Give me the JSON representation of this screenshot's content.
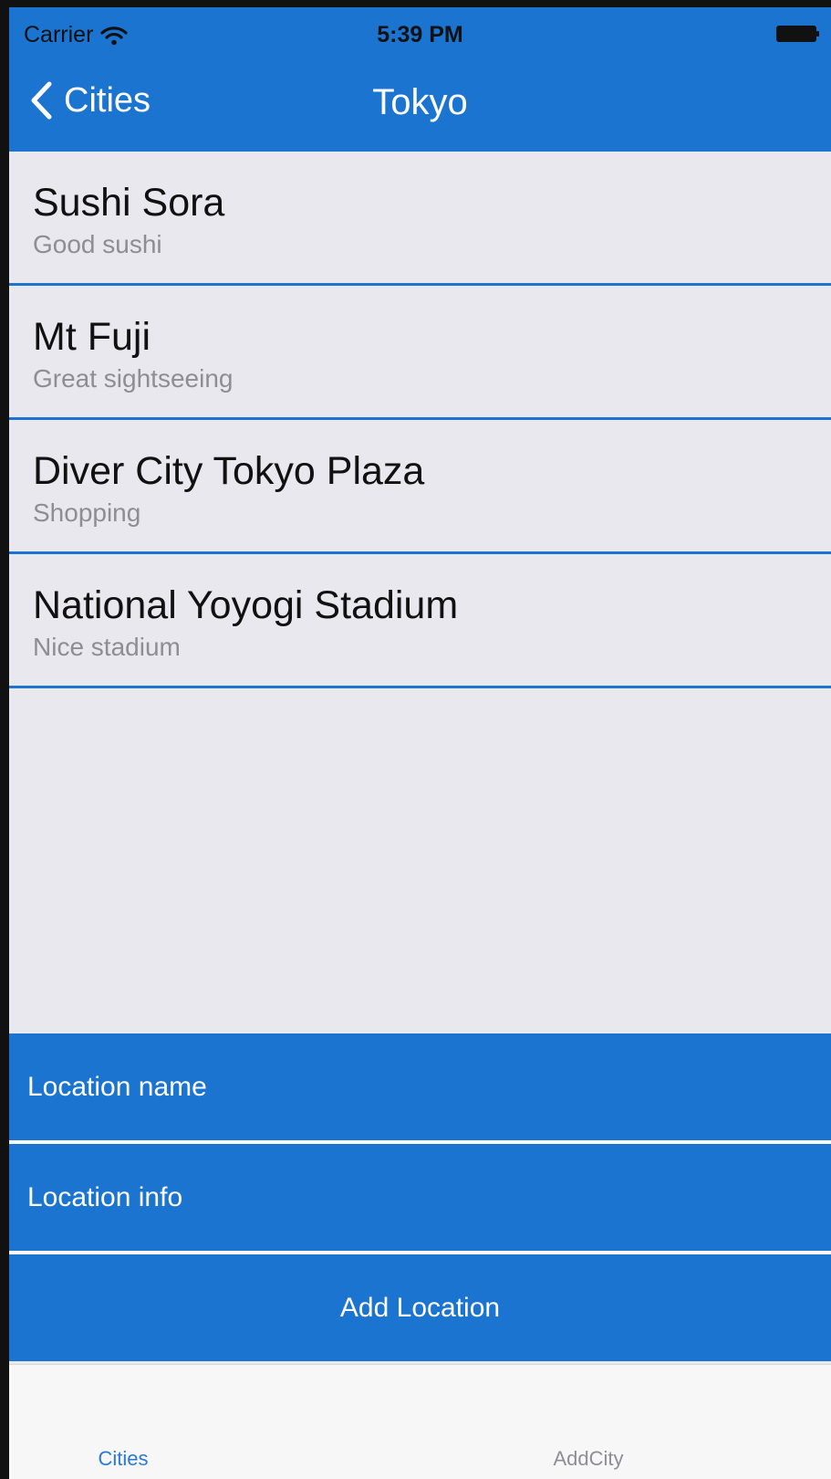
{
  "status_bar": {
    "carrier": "Carrier",
    "time": "5:39 PM"
  },
  "nav": {
    "back_label": "Cities",
    "title": "Tokyo"
  },
  "locations": [
    {
      "name": "Sushi Sora",
      "info": "Good sushi"
    },
    {
      "name": "Mt Fuji",
      "info": "Great sightseeing"
    },
    {
      "name": "Diver City Tokyo Plaza",
      "info": "Shopping"
    },
    {
      "name": "National Yoyogi Stadium",
      "info": "Nice stadium"
    }
  ],
  "form": {
    "name_placeholder": "Location name",
    "info_placeholder": "Location info",
    "name_value": "",
    "info_value": "",
    "add_button_label": "Add Location"
  },
  "tabs": [
    {
      "label": "Cities",
      "active": true
    },
    {
      "label": "AddCity",
      "active": false
    }
  ],
  "colors": {
    "accent": "#1a74d0",
    "background": "#e9e8ee",
    "subtitle": "#8d8d93",
    "tab_active": "#2a7ad6",
    "tab_inactive": "#8e8e93"
  },
  "icons": {
    "wifi": "wifi-icon",
    "battery": "battery-icon",
    "back": "chevron-left-icon"
  }
}
